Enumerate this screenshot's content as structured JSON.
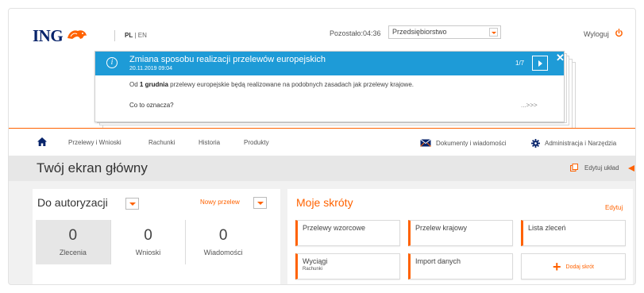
{
  "header": {
    "logo_text": "ING",
    "lang_active": "PL",
    "lang_sep": " | ",
    "lang_other": "EN",
    "remaining_label": "Pozostało:",
    "remaining_time": "04:36",
    "company_select": "Przedsiębiorstwo",
    "logout_label": "Wyloguj"
  },
  "notice": {
    "title": "Zmiana sposobu realizacji przelewów europejskich",
    "date": "20.11.2019 09:04",
    "pager": "1/7",
    "close": "✕",
    "message_lead": "Od ",
    "message_bold": "1 grudnia",
    "message_rest": " przelewy europejskie będą realizowane na podobnych zasadach jak przelewy krajowe.",
    "question": "Co to oznacza?",
    "more": "...>>>"
  },
  "nav": {
    "items": [
      "Przelewy i Wnioski",
      "Rachunki",
      "Historia",
      "Produkty"
    ],
    "documents": "Dokumenty i wiadomości",
    "admin": "Administracja i Narzędzia"
  },
  "dashboard": {
    "title": "Twój ekran główny",
    "edit_layout": "Edytuj układ"
  },
  "auth": {
    "title": "Do autoryzacji",
    "new_transfer": "Nowy przelew",
    "tabs": [
      {
        "count": "0",
        "label": "Zlecenia"
      },
      {
        "count": "0",
        "label": "Wnioski"
      },
      {
        "count": "0",
        "label": "Wiadomości"
      }
    ]
  },
  "shortcuts": {
    "title": "Moje skróty",
    "edit": "Edytuj",
    "tiles": [
      {
        "label": "Przelewy wzorcowe",
        "sub": ""
      },
      {
        "label": "Przelew krajowy",
        "sub": ""
      },
      {
        "label": "Lista zleceń",
        "sub": ""
      },
      {
        "label": "Wyciągi",
        "sub": "Rachunki"
      },
      {
        "label": "Import danych",
        "sub": ""
      }
    ],
    "add": "Dodaj skrót"
  },
  "colors": {
    "accent": "#ff6200",
    "notice": "#1e9bd7",
    "brand_navy": "#08246b"
  }
}
